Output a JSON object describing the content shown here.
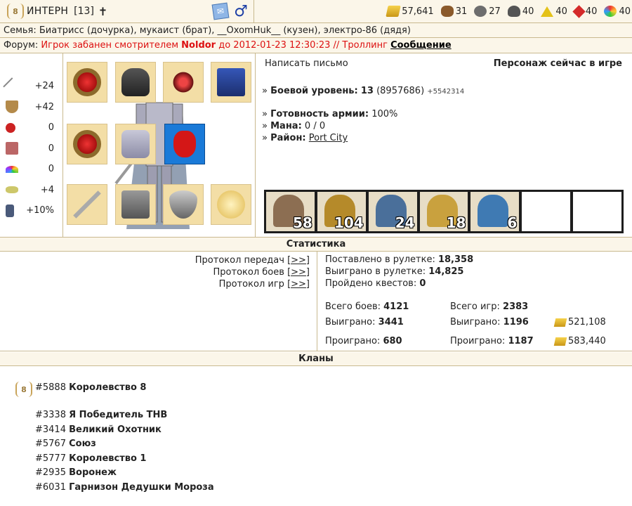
{
  "header": {
    "player_name": "ИНТЕРН",
    "level": "[13]",
    "cross_glyph": "✝",
    "male_glyph": "♂",
    "resources": [
      {
        "icon": "gold-icon",
        "value": "57,641"
      },
      {
        "icon": "wood-icon",
        "value": "31"
      },
      {
        "icon": "ore-icon",
        "value": "27"
      },
      {
        "icon": "mercury-icon",
        "value": "40"
      },
      {
        "icon": "sulfur-icon",
        "value": "40"
      },
      {
        "icon": "crystal-icon",
        "value": "40"
      },
      {
        "icon": "gems-icon",
        "value": "40"
      }
    ]
  },
  "family": {
    "text": "Семья: Биатрисс (дочурка), мукаист (брат), __OxomHuk__ (кузен), электро-86 (дядя)"
  },
  "forum": {
    "prefix": "Форум: ",
    "ban_text_1": "Игрок забанен смотрителем ",
    "moderator": "Noldor",
    "ban_text_2": " до 2012-01-23 12:30:23 // Троллинг ",
    "link": "Сообщение"
  },
  "stats": [
    {
      "icon": "attack-icon",
      "value": "+24"
    },
    {
      "icon": "defense-icon",
      "value": "+42"
    },
    {
      "icon": "spellpower-icon",
      "value": "0"
    },
    {
      "icon": "knowledge-icon",
      "value": "0"
    },
    {
      "icon": "luck-icon",
      "value": "0"
    },
    {
      "icon": "morale-icon",
      "value": "+4"
    },
    {
      "icon": "initiative-icon",
      "value": "+10%"
    }
  ],
  "info": {
    "write_letter": "Написать письмо",
    "online_status": "Персонаж сейчас в игре",
    "combat_level_label": "Боевой уровень:",
    "combat_level_value": "13",
    "combat_level_exp": "(8957686)",
    "combat_level_next": "+5542314",
    "army_ready_label": "Готовность армии:",
    "army_ready_value": "100%",
    "mana_label": "Мана:",
    "mana_value": "0 / 0",
    "district_label": "Район:",
    "district_value": "Port City",
    "bullet": "»"
  },
  "army": [
    {
      "count": "58",
      "color": "#8c6e52"
    },
    {
      "count": "104",
      "color": "#b58a2a"
    },
    {
      "count": "24",
      "color": "#4a6f9a"
    },
    {
      "count": "18",
      "color": "#c9a13e"
    },
    {
      "count": "6",
      "color": "#3f7ab3"
    },
    {
      "count": "",
      "color": ""
    },
    {
      "count": "",
      "color": ""
    }
  ],
  "statistics": {
    "title": "Статистика",
    "protocols": [
      {
        "label": "Протокол передач",
        "link": "[>>]"
      },
      {
        "label": "Протокол боев",
        "link": "[>>]"
      },
      {
        "label": "Протокол игр",
        "link": "[>>]"
      }
    ],
    "roulette_bet_label": "Поставлено в рулетке:",
    "roulette_bet_value": "18,358",
    "roulette_won_label": "Выиграно в рулетке:",
    "roulette_won_value": "14,825",
    "quests_label": "Пройдено квестов:",
    "quests_value": "0",
    "battles_total_label": "Всего боев:",
    "battles_total_value": "4121",
    "battles_won_label": "Выиграно:",
    "battles_won_value": "3441",
    "battles_lost_label": "Проиграно:",
    "battles_lost_value": "680",
    "games_total_label": "Всего игр:",
    "games_total_value": "2383",
    "games_won_label": "Выиграно:",
    "games_won_value": "1196",
    "games_lost_label": "Проиграно:",
    "games_lost_value": "1187",
    "gold_won": "521,108",
    "gold_lost": "583,440"
  },
  "clans": {
    "title": "Кланы",
    "main": {
      "id": "#5888",
      "name": "Королевство 8"
    },
    "list": [
      {
        "id": "#3338",
        "name": "Я Победитель ТНВ"
      },
      {
        "id": "#3414",
        "name": "Великий Охотник"
      },
      {
        "id": "#5767",
        "name": "Союз"
      },
      {
        "id": "#5777",
        "name": "Королевство 1"
      },
      {
        "id": "#2935",
        "name": "Воронеж"
      },
      {
        "id": "#6031",
        "name": "Гарнизон Дедушки Мороза"
      }
    ]
  }
}
